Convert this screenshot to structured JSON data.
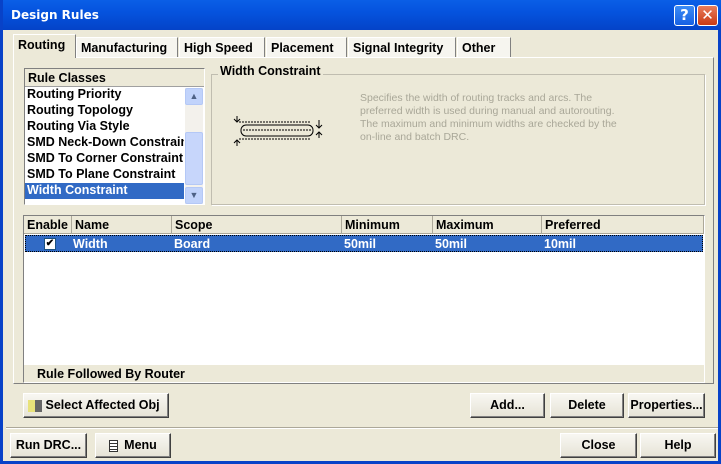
{
  "window": {
    "title": "Design Rules",
    "help_icon": "?",
    "close_icon": "✕"
  },
  "tabs": [
    {
      "label": "Routing",
      "active": true
    },
    {
      "label": "Manufacturing"
    },
    {
      "label": "High Speed"
    },
    {
      "label": "Placement"
    },
    {
      "label": "Signal Integrity"
    },
    {
      "label": "Other"
    }
  ],
  "rule_classes": {
    "header": "Rule Classes",
    "items": [
      "Routing Priority",
      "Routing Topology",
      "Routing Via Style",
      "SMD Neck-Down Constraint",
      "SMD To Corner Constraint",
      "SMD To Plane Constraint",
      "Width Constraint"
    ],
    "selected": "Width Constraint"
  },
  "group": {
    "title": "Width Constraint",
    "description": "Specifies the width of routing tracks and arcs. The preferred width is used during manual and autorouting. The maximum and minimum widths are checked by the on-line and batch DRC."
  },
  "table": {
    "columns": [
      "Enable",
      "Name",
      "Scope",
      "Minimum",
      "Maximum",
      "Preferred"
    ],
    "rows": [
      {
        "enabled": true,
        "name": "Width",
        "scope": "Board",
        "minimum": "50mil",
        "maximum": "50mil",
        "preferred": "10mil"
      }
    ],
    "footer": "Rule Followed By Router"
  },
  "buttons": {
    "select_affected": "Select Affected Obj",
    "add": "Add...",
    "delete": "Delete",
    "properties": "Properties...",
    "run_drc": "Run DRC...",
    "menu": "Menu",
    "close": "Close",
    "help": "Help"
  },
  "colors": {
    "selection": "#316ac5",
    "titlebar": "#0553de",
    "face": "#ece9d8"
  }
}
